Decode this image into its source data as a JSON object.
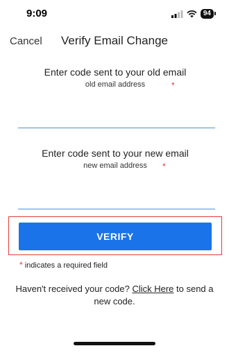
{
  "status_bar": {
    "time": "9:09",
    "battery": "94"
  },
  "nav": {
    "cancel_label": "Cancel",
    "title": "Verify Email Change"
  },
  "old_email": {
    "label": "Enter code sent to your old email",
    "sublabel": "old email address",
    "required_mark": "*",
    "value": ""
  },
  "new_email": {
    "label": "Enter code sent to your new email",
    "sublabel": "new email address",
    "required_mark": "*",
    "value": ""
  },
  "verify_button": {
    "label": "VERIFY"
  },
  "required_note": {
    "mark": "*",
    "text": " indicates a required field"
  },
  "resend": {
    "prefix": "Haven't received your code? ",
    "link": "Click Here",
    "suffix": " to send a new code."
  },
  "colors": {
    "accent": "#1a73e8",
    "required": "#e53935",
    "underline": "#4a90d9"
  }
}
